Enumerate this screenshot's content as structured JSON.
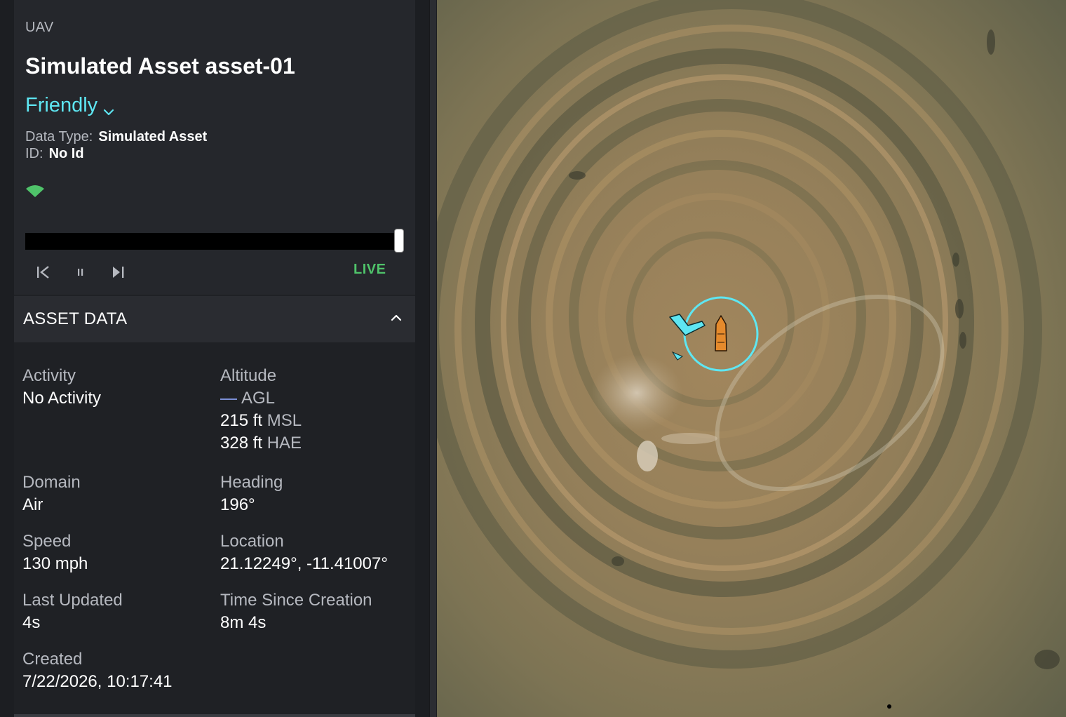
{
  "asset": {
    "type_label": "UAV",
    "title": "Simulated Asset asset-01",
    "affiliation": "Friendly",
    "data_type_label": "Data Type:",
    "data_type_value": "Simulated Asset",
    "id_label": "ID:",
    "id_value": "No Id"
  },
  "playback": {
    "live_label": "LIVE",
    "progress": 1.0
  },
  "section": {
    "title": "ASSET DATA"
  },
  "fields": {
    "activity": {
      "label": "Activity",
      "value": "No Activity"
    },
    "altitude": {
      "label": "Altitude",
      "agl": "AGL",
      "msl_value": "215 ft",
      "msl_unit": "MSL",
      "hae_value": "328 ft",
      "hae_unit": "HAE"
    },
    "domain": {
      "label": "Domain",
      "value": "Air"
    },
    "heading": {
      "label": "Heading",
      "value": "196°"
    },
    "speed": {
      "label": "Speed",
      "value": "130 mph"
    },
    "location": {
      "label": "Location",
      "value": "21.12249°, -11.41007°"
    },
    "last_updated": {
      "label": "Last Updated",
      "value": "4s"
    },
    "time_since_creation": {
      "label": "Time Since Creation",
      "value": "8m 4s"
    },
    "created": {
      "label": "Created",
      "value": "7/22/2026, 10:17:41"
    }
  },
  "colors": {
    "friendly": "#5ee6f2",
    "live": "#4fc36a",
    "signal": "#4fc36a",
    "agl_line": "#7b8fd6",
    "selection_ring": "#5ee6f2",
    "track_marker": "#e58a2c"
  },
  "icons": {
    "affiliation_dropdown": "chevron-down-icon",
    "signal": "signal-icon",
    "skip_back": "skip-back-icon",
    "pause": "pause-icon",
    "skip_forward": "skip-forward-icon",
    "collapse": "chevron-up-icon",
    "aircraft": "aircraft-icon",
    "vessel": "vessel-icon"
  }
}
